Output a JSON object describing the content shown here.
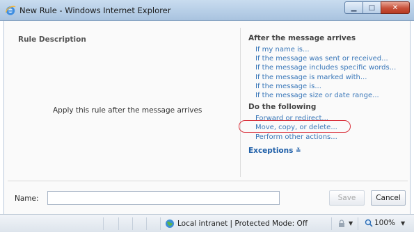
{
  "window": {
    "title": "New Rule - Windows Internet Explorer",
    "minimize_symbol": "▁",
    "maximize_symbol": "□",
    "close_symbol": "✕"
  },
  "left_panel": {
    "heading": "Rule Description",
    "description": "Apply this rule after the message arrives"
  },
  "conditions": {
    "heading": "After the message arrives",
    "items": [
      "If my name is...",
      "If the message was sent or received...",
      "If the message includes specific words...",
      "If the message is marked with...",
      "If the message is...",
      "If the message size or date range..."
    ]
  },
  "actions": {
    "heading": "Do the following",
    "items": [
      "Forward or redirect...",
      "Move, copy, or delete...",
      "Perform other actions..."
    ],
    "highlighted_item": "Forward or redirect..."
  },
  "exceptions": {
    "label": "Exceptions",
    "chevron": "≚"
  },
  "footer": {
    "name_label": "Name:",
    "name_value": "",
    "save_label": "Save",
    "cancel_label": "Cancel"
  },
  "statusbar": {
    "zone_text": "Local intranet | Protected Mode: Off",
    "zoom_text": "100%",
    "dropdown_symbol": "▼"
  },
  "colors": {
    "link": "#3876b8",
    "highlight_ring": "#d9303a",
    "titlebar": "#b5cde6"
  },
  "icons": {
    "title_icon": "ie-e-icon",
    "zone_icon": "globe-icon",
    "zoom_icon": "zoom-magnifier-icon",
    "security_icon": "security-lock-icon"
  }
}
